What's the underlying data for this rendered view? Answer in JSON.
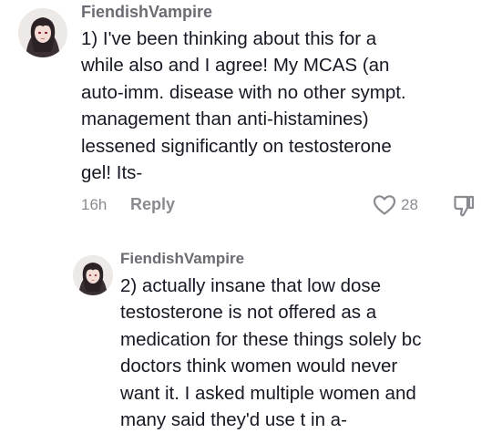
{
  "comments": [
    {
      "username": "FiendishVampire",
      "text": "1) I've been thinking about this for a\nwhile also and I agree! My MCAS (an\nauto-imm. disease with no other sympt.\nmanagement than anti-histamines)\nlessened significantly on testosterone\ngel! Its-",
      "time": "16h",
      "reply_label": "Reply",
      "like_count": "28",
      "icons": {
        "like": "heart-outline-icon",
        "dislike": "thumbs-down-icon"
      }
    },
    {
      "username": "FiendishVampire",
      "text": "2) actually insane that low dose\ntestosterone is not offered as a\nmedication for these things solely bc\ndoctors think women would never\nwant it. I asked multiple women and\nmany said they'd use t in a-"
    }
  ],
  "colors": {
    "text": "#161823",
    "muted": "#8a8b91",
    "username": "#6b6b73",
    "background": "#ffffff"
  }
}
